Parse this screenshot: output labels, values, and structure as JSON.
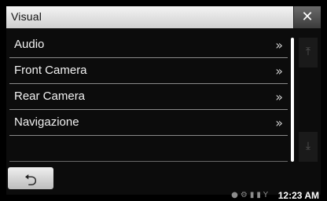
{
  "header": {
    "title": "Visual",
    "close_symbol": "✕"
  },
  "menu": {
    "items": [
      {
        "label": "Audio",
        "chevron": "»"
      },
      {
        "label": "Front Camera",
        "chevron": "»"
      },
      {
        "label": "Rear Camera",
        "chevron": "»"
      },
      {
        "label": "Navigazione",
        "chevron": "»"
      }
    ]
  },
  "scroll": {
    "up_symbol": "⤒",
    "down_symbol": "⤓"
  },
  "footer": {
    "back_symbol": "⮌"
  },
  "status": {
    "icons": [
      "gps-icon",
      "bluetooth-icon",
      "battery-icon",
      "signal-icon"
    ],
    "time": "12:23 AM"
  }
}
